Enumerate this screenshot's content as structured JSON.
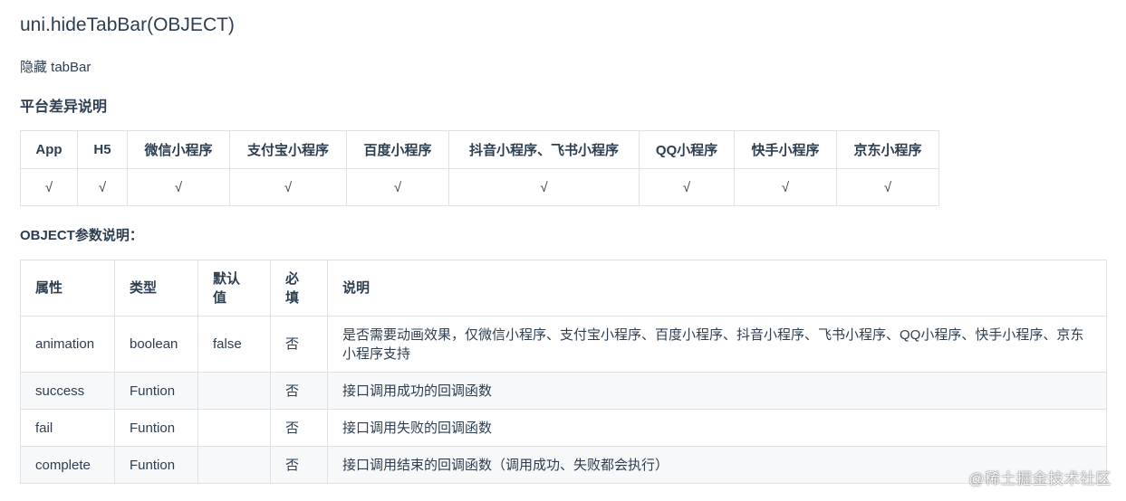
{
  "title": "uni.hideTabBar(OBJECT)",
  "description": "隐藏 tabBar",
  "platform_section": {
    "title": "平台差异说明",
    "headers": [
      "App",
      "H5",
      "微信小程序",
      "支付宝小程序",
      "百度小程序",
      "抖音小程序、飞书小程序",
      "QQ小程序",
      "快手小程序",
      "京东小程序"
    ],
    "values": [
      "√",
      "√",
      "√",
      "√",
      "√",
      "√",
      "√",
      "√",
      "√"
    ]
  },
  "object_section": {
    "title": "OBJECT参数说明：",
    "headers": {
      "attr": "属性",
      "type": "类型",
      "default_line1": "默认",
      "default_line2": "值",
      "required_line1": "必",
      "required_line2": "填",
      "desc": "说明"
    },
    "rows": [
      {
        "attr": "animation",
        "type": "boolean",
        "default": "false",
        "required": "否",
        "desc": "是否需要动画效果，仅微信小程序、支付宝小程序、百度小程序、抖音小程序、飞书小程序、QQ小程序、快手小程序、京东小程序支持"
      },
      {
        "attr": "success",
        "type": "Funtion",
        "default": "",
        "required": "否",
        "desc": "接口调用成功的回调函数"
      },
      {
        "attr": "fail",
        "type": "Funtion",
        "default": "",
        "required": "否",
        "desc": "接口调用失败的回调函数"
      },
      {
        "attr": "complete",
        "type": "Funtion",
        "default": "",
        "required": "否",
        "desc": "接口调用结束的回调函数（调用成功、失败都会执行）"
      }
    ]
  },
  "watermark": "@稀土掘金技术社区"
}
